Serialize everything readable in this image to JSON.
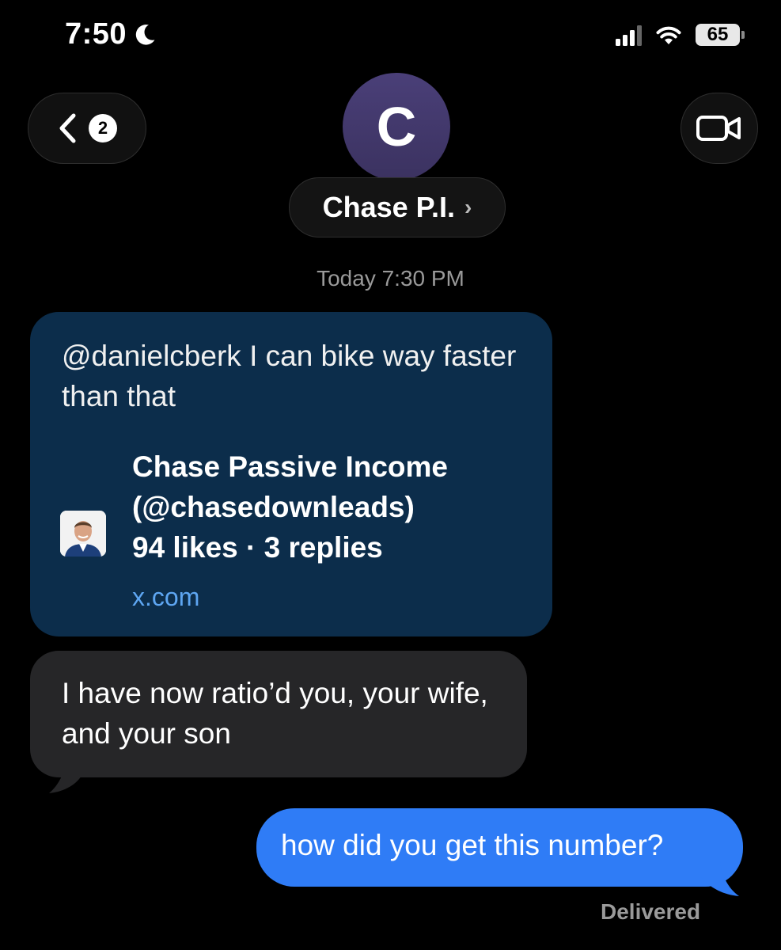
{
  "status_bar": {
    "time": "7:50",
    "battery": "65"
  },
  "header": {
    "back_badge_count": "2",
    "avatar_initial": "C",
    "contact_name": "Chase P.I.",
    "contact_chevron": "›"
  },
  "conversation": {
    "timestamp": "Today 7:30 PM",
    "messages": [
      {
        "type": "received_link",
        "text": "@danielcberk I can bike way faster than that",
        "link": {
          "title_line1": "Chase Passive Income",
          "title_line2": "(@chasedownleads)",
          "title_line3": "94 likes · 3 replies",
          "domain": "x.com"
        }
      },
      {
        "type": "received",
        "text": "I have now ratio’d you, your wife, and your son"
      },
      {
        "type": "sent",
        "text": "how did you get this number?",
        "status": "Delivered"
      }
    ]
  },
  "colors": {
    "background": "#000000",
    "link_bubble": "#0c2d4b",
    "received_bubble": "#262628",
    "sent_bubble": "#2f7cf6",
    "link_domain": "#5ea6f2"
  },
  "icons": [
    "moon-icon",
    "signal-icon",
    "wifi-icon",
    "battery-icon",
    "back-chevron-icon",
    "video-camera-icon"
  ]
}
